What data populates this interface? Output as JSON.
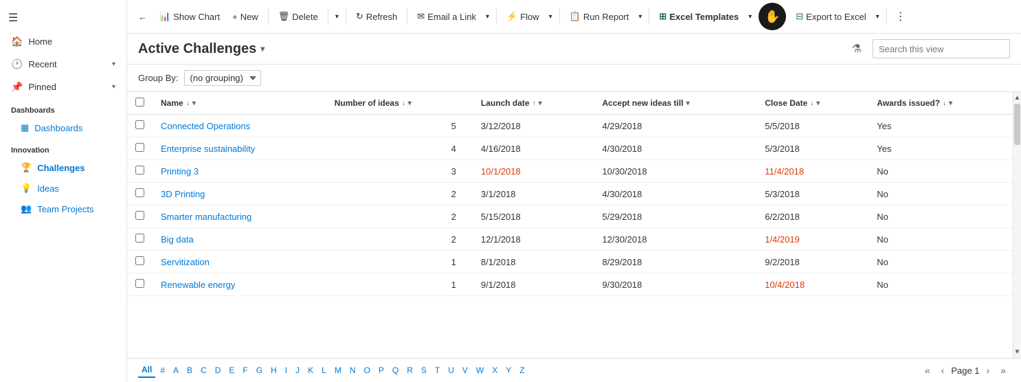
{
  "sidebar": {
    "nav_items": [
      {
        "id": "home",
        "label": "Home",
        "icon": "🏠",
        "hasChevron": false
      },
      {
        "id": "recent",
        "label": "Recent",
        "icon": "🕐",
        "hasChevron": true
      },
      {
        "id": "pinned",
        "label": "Pinned",
        "icon": "📌",
        "hasChevron": true
      }
    ],
    "sections": [
      {
        "id": "dashboards",
        "title": "Dashboards",
        "items": [
          {
            "id": "dashboards-item",
            "label": "Dashboards",
            "icon": "▦"
          }
        ]
      },
      {
        "id": "innovation",
        "title": "Innovation",
        "items": [
          {
            "id": "challenges",
            "label": "Challenges",
            "icon": "🏆",
            "active": true
          },
          {
            "id": "ideas",
            "label": "Ideas",
            "icon": "💡"
          },
          {
            "id": "team-projects",
            "label": "Team Projects",
            "icon": "👥"
          }
        ]
      }
    ]
  },
  "toolbar": {
    "back_label": "←",
    "show_chart_label": "Show Chart",
    "new_label": "New",
    "delete_label": "Delete",
    "refresh_label": "Refresh",
    "email_link_label": "Email a Link",
    "flow_label": "Flow",
    "run_report_label": "Run Report",
    "excel_templates_label": "Excel Templates",
    "export_excel_label": "Export to Excel"
  },
  "header": {
    "title": "Active Challenges",
    "search_placeholder": "Search this view"
  },
  "groupby": {
    "label": "Group By:",
    "value": "(no grouping)"
  },
  "columns": [
    {
      "id": "name",
      "label": "Name",
      "sort": "asc",
      "sortIcon": "↓",
      "hasChevron": true
    },
    {
      "id": "num-ideas",
      "label": "Number of ideas",
      "sort": "desc",
      "sortIcon": "↓",
      "hasChevron": true
    },
    {
      "id": "launch-date",
      "label": "Launch date",
      "sort": "asc",
      "sortIcon": "↑",
      "hasChevron": true
    },
    {
      "id": "accept-till",
      "label": "Accept new ideas till",
      "sort": "none",
      "sortIcon": "",
      "hasChevron": true
    },
    {
      "id": "close-date",
      "label": "Close Date",
      "sort": "none",
      "sortIcon": "↓",
      "hasChevron": true
    },
    {
      "id": "awards-issued",
      "label": "Awards issued?",
      "sort": "none",
      "sortIcon": "↓",
      "hasChevron": true
    }
  ],
  "rows": [
    {
      "name": "Connected Operations",
      "numIdeas": "5",
      "launchDate": "3/12/2018",
      "launchOverdue": false,
      "acceptTill": "4/29/2018",
      "acceptOverdue": false,
      "closeDate": "5/5/2018",
      "closeOverdue": false,
      "awardsIssued": "Yes"
    },
    {
      "name": "Enterprise sustainability",
      "numIdeas": "4",
      "launchDate": "4/16/2018",
      "launchOverdue": false,
      "acceptTill": "4/30/2018",
      "acceptOverdue": false,
      "closeDate": "5/3/2018",
      "closeOverdue": false,
      "awardsIssued": "Yes"
    },
    {
      "name": "Printing 3",
      "numIdeas": "3",
      "launchDate": "10/1/2018",
      "launchOverdue": true,
      "acceptTill": "10/30/2018",
      "acceptOverdue": false,
      "closeDate": "11/4/2018",
      "closeOverdue": true,
      "awardsIssued": "No"
    },
    {
      "name": "3D Printing",
      "numIdeas": "2",
      "launchDate": "3/1/2018",
      "launchOverdue": false,
      "acceptTill": "4/30/2018",
      "acceptOverdue": false,
      "closeDate": "5/3/2018",
      "closeOverdue": false,
      "awardsIssued": "No"
    },
    {
      "name": "Smarter manufacturing",
      "numIdeas": "2",
      "launchDate": "5/15/2018",
      "launchOverdue": false,
      "acceptTill": "5/29/2018",
      "acceptOverdue": false,
      "closeDate": "6/2/2018",
      "closeOverdue": false,
      "awardsIssued": "No"
    },
    {
      "name": "Big data",
      "numIdeas": "2",
      "launchDate": "12/1/2018",
      "launchOverdue": false,
      "acceptTill": "12/30/2018",
      "acceptOverdue": false,
      "closeDate": "1/4/2019",
      "closeOverdue": true,
      "awardsIssued": "No"
    },
    {
      "name": "Servitization",
      "numIdeas": "1",
      "launchDate": "8/1/2018",
      "launchOverdue": false,
      "acceptTill": "8/29/2018",
      "acceptOverdue": false,
      "closeDate": "9/2/2018",
      "closeOverdue": false,
      "awardsIssued": "No"
    },
    {
      "name": "Renewable energy",
      "numIdeas": "1",
      "launchDate": "9/1/2018",
      "launchOverdue": false,
      "acceptTill": "9/30/2018",
      "acceptOverdue": false,
      "closeDate": "10/4/2018",
      "closeOverdue": true,
      "awardsIssued": "No"
    }
  ],
  "pagination": {
    "alpha_links": [
      "All",
      "#",
      "A",
      "B",
      "C",
      "D",
      "E",
      "F",
      "G",
      "H",
      "I",
      "J",
      "K",
      "L",
      "M",
      "N",
      "O",
      "P",
      "Q",
      "R",
      "S",
      "T",
      "U",
      "V",
      "W",
      "X",
      "Y",
      "Z"
    ],
    "active_link": "All",
    "page_label": "Page 1",
    "prev_icon": "‹",
    "next_icon": "›",
    "first_icon": "«",
    "last_icon": "»"
  }
}
